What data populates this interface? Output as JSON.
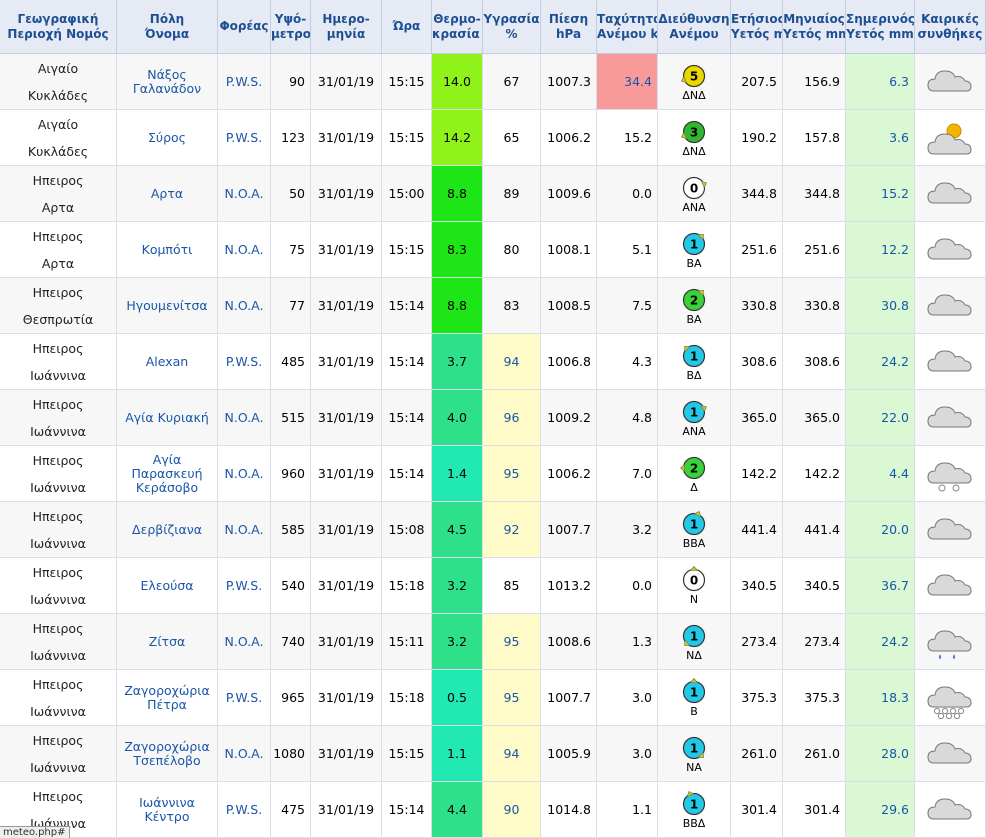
{
  "headers": [
    {
      "l1": "Γεωγραφική",
      "l2": "Περιοχή Νομός"
    },
    {
      "l1": "Πόλη",
      "l2": "Όνομα"
    },
    {
      "l1": "Φορέας",
      "l2": ""
    },
    {
      "l1": "Υψό-",
      "l2": "μετρο m"
    },
    {
      "l1": "Ημερο-",
      "l2": "μηνία"
    },
    {
      "l1": "Ώρα",
      "l2": ""
    },
    {
      "l1": "Θερμο-",
      "l2": "κρασία °C"
    },
    {
      "l1": "Υγρασία",
      "l2": "%"
    },
    {
      "l1": "Πίεση",
      "l2": "hPa"
    },
    {
      "l1": "Ταχύτητα",
      "l2": "Ανέμου km/h"
    },
    {
      "l1": "Διεύθυνση",
      "l2": "Ανέμου"
    },
    {
      "l1": "Ετήσιος",
      "l2": "Υετός mm"
    },
    {
      "l1": "Μηνιαίος",
      "l2": "Υετός mm"
    },
    {
      "l1": "Σημερινός",
      "l2": "Υετός mm"
    },
    {
      "l1": "Καιρικές",
      "l2": "συνθήκες"
    }
  ],
  "colors": {
    "header_bg": "#e5eaf4",
    "header_text": "#1f4f93",
    "link": "#1a56a8",
    "temp_yellowgreen": "#8ff219",
    "temp_green": "#4ae020",
    "temp_bright": "#1ee616",
    "temp_cool": "#2fe08a",
    "temp_teal": "#22e8b2",
    "humid_bg": "#fefbc9",
    "wind_high_bg": "#f8999a",
    "today_rain_bg": "#d9f8d3"
  },
  "rows": [
    {
      "region": "Αιγαίο",
      "prefecture": "Κυκλάδες",
      "city": "Νάξος Γαλανάδον",
      "provider": "P.W.S.",
      "altitude": "90",
      "date": "31/01/19",
      "time": "15:15",
      "temp": "14.0",
      "temp_color": "#8ff219",
      "humidity": "67",
      "humid_hl": false,
      "pressure": "1007.3",
      "wind_speed": "34.4",
      "wind_hl": true,
      "beaufort": "5",
      "wind_dir": "ΔΝΔ",
      "bearing": 248,
      "bcolor": "#e8d800",
      "annual": "207.5",
      "monthly": "156.9",
      "today": "6.3",
      "weather": "cloud"
    },
    {
      "region": "Αιγαίο",
      "prefecture": "Κυκλάδες",
      "city": "Σύρος",
      "provider": "P.W.S.",
      "altitude": "123",
      "date": "31/01/19",
      "time": "15:15",
      "temp": "14.2",
      "temp_color": "#8ff219",
      "humidity": "65",
      "humid_hl": false,
      "pressure": "1006.2",
      "wind_speed": "15.2",
      "wind_hl": false,
      "beaufort": "3",
      "wind_dir": "ΔΝΔ",
      "bearing": 248,
      "bcolor": "#2fb82f",
      "annual": "190.2",
      "monthly": "157.8",
      "today": "3.6",
      "weather": "sun-cloud"
    },
    {
      "region": "Ηπειρος",
      "prefecture": "Αρτα",
      "city": "Αρτα",
      "provider": "N.O.A.",
      "altitude": "50",
      "date": "31/01/19",
      "time": "15:00",
      "temp": "8.8",
      "temp_color": "#1ee616",
      "humidity": "89",
      "humid_hl": false,
      "pressure": "1009.6",
      "wind_speed": "0.0",
      "wind_hl": false,
      "beaufort": "0",
      "wind_dir": "ΑΝΑ",
      "bearing": 68,
      "bcolor": "#ffffff",
      "annual": "344.8",
      "monthly": "344.8",
      "today": "15.2",
      "weather": "cloud"
    },
    {
      "region": "Ηπειρος",
      "prefecture": "Αρτα",
      "city": "Κομπότι",
      "provider": "N.O.A.",
      "altitude": "75",
      "date": "31/01/19",
      "time": "15:15",
      "temp": "8.3",
      "temp_color": "#1ee616",
      "humidity": "80",
      "humid_hl": false,
      "pressure": "1008.1",
      "wind_speed": "5.1",
      "wind_hl": false,
      "beaufort": "1",
      "wind_dir": "ΒΑ",
      "bearing": 45,
      "bcolor": "#22c8e8",
      "annual": "251.6",
      "monthly": "251.6",
      "today": "12.2",
      "weather": "cloud"
    },
    {
      "region": "Ηπειρος",
      "prefecture": "Θεσπρωτία",
      "city": "Ηγουμενίτσα",
      "provider": "N.O.A.",
      "altitude": "77",
      "date": "31/01/19",
      "time": "15:14",
      "temp": "8.8",
      "temp_color": "#1ee616",
      "humidity": "83",
      "humid_hl": false,
      "pressure": "1008.5",
      "wind_speed": "7.5",
      "wind_hl": false,
      "beaufort": "2",
      "wind_dir": "ΒΑ",
      "bearing": 45,
      "bcolor": "#3ad23a",
      "annual": "330.8",
      "monthly": "330.8",
      "today": "30.8",
      "weather": "cloud"
    },
    {
      "region": "Ηπειρος",
      "prefecture": "Ιωάννινα",
      "city": "Alexan",
      "provider": "P.W.S.",
      "altitude": "485",
      "date": "31/01/19",
      "time": "15:14",
      "temp": "3.7",
      "temp_color": "#2fe08a",
      "humidity": "94",
      "humid_hl": true,
      "pressure": "1006.8",
      "wind_speed": "4.3",
      "wind_hl": false,
      "beaufort": "1",
      "wind_dir": "ΒΔ",
      "bearing": 315,
      "bcolor": "#22c8e8",
      "annual": "308.6",
      "monthly": "308.6",
      "today": "24.2",
      "weather": "cloud"
    },
    {
      "region": "Ηπειρος",
      "prefecture": "Ιωάννινα",
      "city": "Αγία Κυριακή",
      "provider": "N.O.A.",
      "altitude": "515",
      "date": "31/01/19",
      "time": "15:14",
      "temp": "4.0",
      "temp_color": "#2fe08a",
      "humidity": "96",
      "humid_hl": true,
      "pressure": "1009.2",
      "wind_speed": "4.8",
      "wind_hl": false,
      "beaufort": "1",
      "wind_dir": "ΑΝΑ",
      "bearing": 68,
      "bcolor": "#22c8e8",
      "annual": "365.0",
      "monthly": "365.0",
      "today": "22.0",
      "weather": "cloud"
    },
    {
      "region": "Ηπειρος",
      "prefecture": "Ιωάννινα",
      "city": "Αγία Παρασκευή Κεράσοβο",
      "provider": "N.O.A.",
      "altitude": "960",
      "date": "31/01/19",
      "time": "15:14",
      "temp": "1.4",
      "temp_color": "#22e8b2",
      "humidity": "95",
      "humid_hl": true,
      "pressure": "1006.2",
      "wind_speed": "7.0",
      "wind_hl": false,
      "beaufort": "2",
      "wind_dir": "Δ",
      "bearing": 270,
      "bcolor": "#3ad23a",
      "annual": "142.2",
      "monthly": "142.2",
      "today": "4.4",
      "weather": "cloud-snow"
    },
    {
      "region": "Ηπειρος",
      "prefecture": "Ιωάννινα",
      "city": "Δερβίζιανα",
      "provider": "N.O.A.",
      "altitude": "585",
      "date": "31/01/19",
      "time": "15:08",
      "temp": "4.5",
      "temp_color": "#2fe08a",
      "humidity": "92",
      "humid_hl": true,
      "pressure": "1007.7",
      "wind_speed": "3.2",
      "wind_hl": false,
      "beaufort": "1",
      "wind_dir": "ΒΒΑ",
      "bearing": 22,
      "bcolor": "#22c8e8",
      "annual": "441.4",
      "monthly": "441.4",
      "today": "20.0",
      "weather": "cloud"
    },
    {
      "region": "Ηπειρος",
      "prefecture": "Ιωάννινα",
      "city": "Ελεούσα",
      "provider": "P.W.S.",
      "altitude": "540",
      "date": "31/01/19",
      "time": "15:18",
      "temp": "3.2",
      "temp_color": "#2fe08a",
      "humidity": "85",
      "humid_hl": false,
      "pressure": "1013.2",
      "wind_speed": "0.0",
      "wind_hl": false,
      "beaufort": "0",
      "wind_dir": "N",
      "bearing": 0,
      "bcolor": "#ffffff",
      "annual": "340.5",
      "monthly": "340.5",
      "today": "36.7",
      "weather": "cloud"
    },
    {
      "region": "Ηπειρος",
      "prefecture": "Ιωάννινα",
      "city": "Ζίτσα",
      "provider": "N.O.A.",
      "altitude": "740",
      "date": "31/01/19",
      "time": "15:11",
      "temp": "3.2",
      "temp_color": "#2fe08a",
      "humidity": "95",
      "humid_hl": true,
      "pressure": "1008.6",
      "wind_speed": "1.3",
      "wind_hl": false,
      "beaufort": "1",
      "wind_dir": "ΝΔ",
      "bearing": 225,
      "bcolor": "#22c8e8",
      "annual": "273.4",
      "monthly": "273.4",
      "today": "24.2",
      "weather": "cloud-rain"
    },
    {
      "region": "Ηπειρος",
      "prefecture": "Ιωάννινα",
      "city": "Ζαγοροχώρια Πέτρα",
      "provider": "P.W.S.",
      "altitude": "965",
      "date": "31/01/19",
      "time": "15:18",
      "temp": "0.5",
      "temp_color": "#22e8b2",
      "humidity": "95",
      "humid_hl": true,
      "pressure": "1007.7",
      "wind_speed": "3.0",
      "wind_hl": false,
      "beaufort": "1",
      "wind_dir": "B",
      "bearing": 0,
      "bcolor": "#22c8e8",
      "annual": "375.3",
      "monthly": "375.3",
      "today": "18.3",
      "weather": "cloud-heavysnow"
    },
    {
      "region": "Ηπειρος",
      "prefecture": "Ιωάννινα",
      "city": "Ζαγοροχώρια Τσεπέλοβο",
      "provider": "N.O.A.",
      "altitude": "1080",
      "date": "31/01/19",
      "time": "15:15",
      "temp": "1.1",
      "temp_color": "#22e8b2",
      "humidity": "94",
      "humid_hl": true,
      "pressure": "1005.9",
      "wind_speed": "3.0",
      "wind_hl": false,
      "beaufort": "1",
      "wind_dir": "NA",
      "bearing": 135,
      "bcolor": "#22c8e8",
      "annual": "261.0",
      "monthly": "261.0",
      "today": "28.0",
      "weather": "cloud"
    },
    {
      "region": "Ηπειρος",
      "prefecture": "Ιωάννινα",
      "city": "Ιωάννινα Κέντρο",
      "provider": "P.W.S.",
      "altitude": "475",
      "date": "31/01/19",
      "time": "15:14",
      "temp": "4.4",
      "temp_color": "#2fe08a",
      "humidity": "90",
      "humid_hl": true,
      "pressure": "1014.8",
      "wind_speed": "1.1",
      "wind_hl": false,
      "beaufort": "1",
      "wind_dir": "ΒΒΔ",
      "bearing": 338,
      "bcolor": "#22c8e8",
      "annual": "301.4",
      "monthly": "301.4",
      "today": "29.6",
      "weather": "cloud"
    }
  ],
  "statusbar": {
    "url": "meteo.php#"
  }
}
